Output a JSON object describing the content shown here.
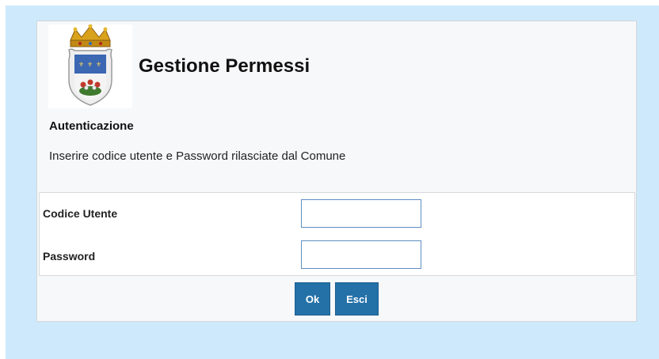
{
  "app": {
    "title": "Gestione Permessi"
  },
  "auth": {
    "section_title": "Autenticazione",
    "instructions": "Inserire codice utente e Password rilasciate dal Comune"
  },
  "form": {
    "user_label": "Codice Utente",
    "user_value": "",
    "password_label": "Password",
    "password_value": ""
  },
  "buttons": {
    "ok_label": "Ok",
    "esci_label": "Esci"
  },
  "colors": {
    "background": "#cde9fb",
    "panel": "#f7f8fa",
    "button": "#2471a8",
    "input_border": "#5d8fc0"
  },
  "icons": {
    "logo": "municipal-coat-of-arms-icon"
  }
}
